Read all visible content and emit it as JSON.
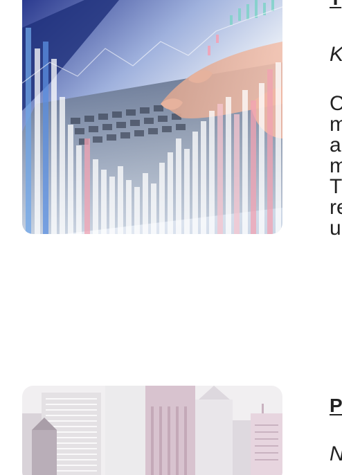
{
  "article_1": {
    "heading": "T",
    "subtitle": "K",
    "body_lines": [
      "C",
      "m",
      "a",
      "m",
      "T",
      "re",
      "u"
    ],
    "image_alt": "Hand typing on laptop with financial chart overlay"
  },
  "article_2": {
    "heading": "P",
    "subtitle": "N",
    "image_alt": "City skyline buildings"
  },
  "colors": {
    "text": "#222222",
    "background": "#ffffff"
  }
}
